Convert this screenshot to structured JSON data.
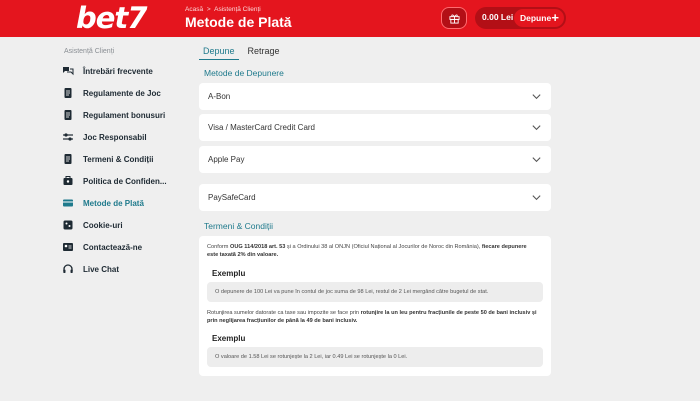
{
  "header": {
    "logo_text": "bet",
    "logo_seven": "7",
    "breadcrumb": [
      "Acasă",
      "Asistență Clienți"
    ],
    "breadcrumb_sep": ">",
    "title": "Metode de Plată",
    "balance": "0.00 Lei",
    "deposit_label": "Depune",
    "deposit_plus": "+",
    "gift_icon": "gift-icon"
  },
  "sidebar": {
    "heading": "Asistență Clienți",
    "items": [
      {
        "label": "Întrebări frecvente",
        "icon": "faq-icon"
      },
      {
        "label": "Regulamente de Joc",
        "icon": "document-icon"
      },
      {
        "label": "Regulament bonusuri",
        "icon": "document-icon"
      },
      {
        "label": "Joc Responsabil",
        "icon": "sliders-icon"
      },
      {
        "label": "Termeni & Condiții",
        "icon": "document-icon"
      },
      {
        "label": "Politica de Confiden...",
        "icon": "shield-icon"
      },
      {
        "label": "Metode de Plată",
        "icon": "card-icon",
        "active": true
      },
      {
        "label": "Cookie-uri",
        "icon": "cookie-icon"
      },
      {
        "label": "Contactează-ne",
        "icon": "contact-icon"
      },
      {
        "label": "Live Chat",
        "icon": "headset-icon"
      }
    ]
  },
  "tabs": [
    {
      "label": "Depune",
      "active": true
    },
    {
      "label": "Retrage",
      "active": false
    }
  ],
  "deposit_methods_title": "Metode de Depunere",
  "methods": [
    "A-Bon",
    "Visa / MasterCard Credit Card",
    "Apple Pay",
    "PaySafeCard"
  ],
  "terms": {
    "title": "Termeni & Condiții",
    "p1_a": "Conform ",
    "p1_b": "OUG 114/2018 art. 53",
    "p1_c": " și a Ordinului 38 al ONJN (Oficiul Național al Jocurilor de Noroc din România), ",
    "p1_d": "fiecare depunere este taxată 2% din valoare.",
    "example_title_1": "Exemplu",
    "example_1": "O depunere de 100 Lei va pune în contul de joc suma de 98 Lei, restul de 2 Lei mergând către bugetul de stat.",
    "p2_a": "Rotunjirea sumelor datorate ca taxe sau impozite se face prin ",
    "p2_b": "rotunjire la un leu pentru fracțiunile de peste 50 de bani inclusiv și prin neglijarea fracțiunilor de până la 49 de bani inclusiv.",
    "example_title_2": "Exemplu",
    "example_2": "O valoare de 1.58 Lei se rotunjește la 2 Lei, iar 0.49 Lei se rotunjește la 0 Lei."
  },
  "colors": {
    "brand_red": "#e4151e",
    "accent_teal": "#1f7a8c",
    "background": "#efefef"
  }
}
